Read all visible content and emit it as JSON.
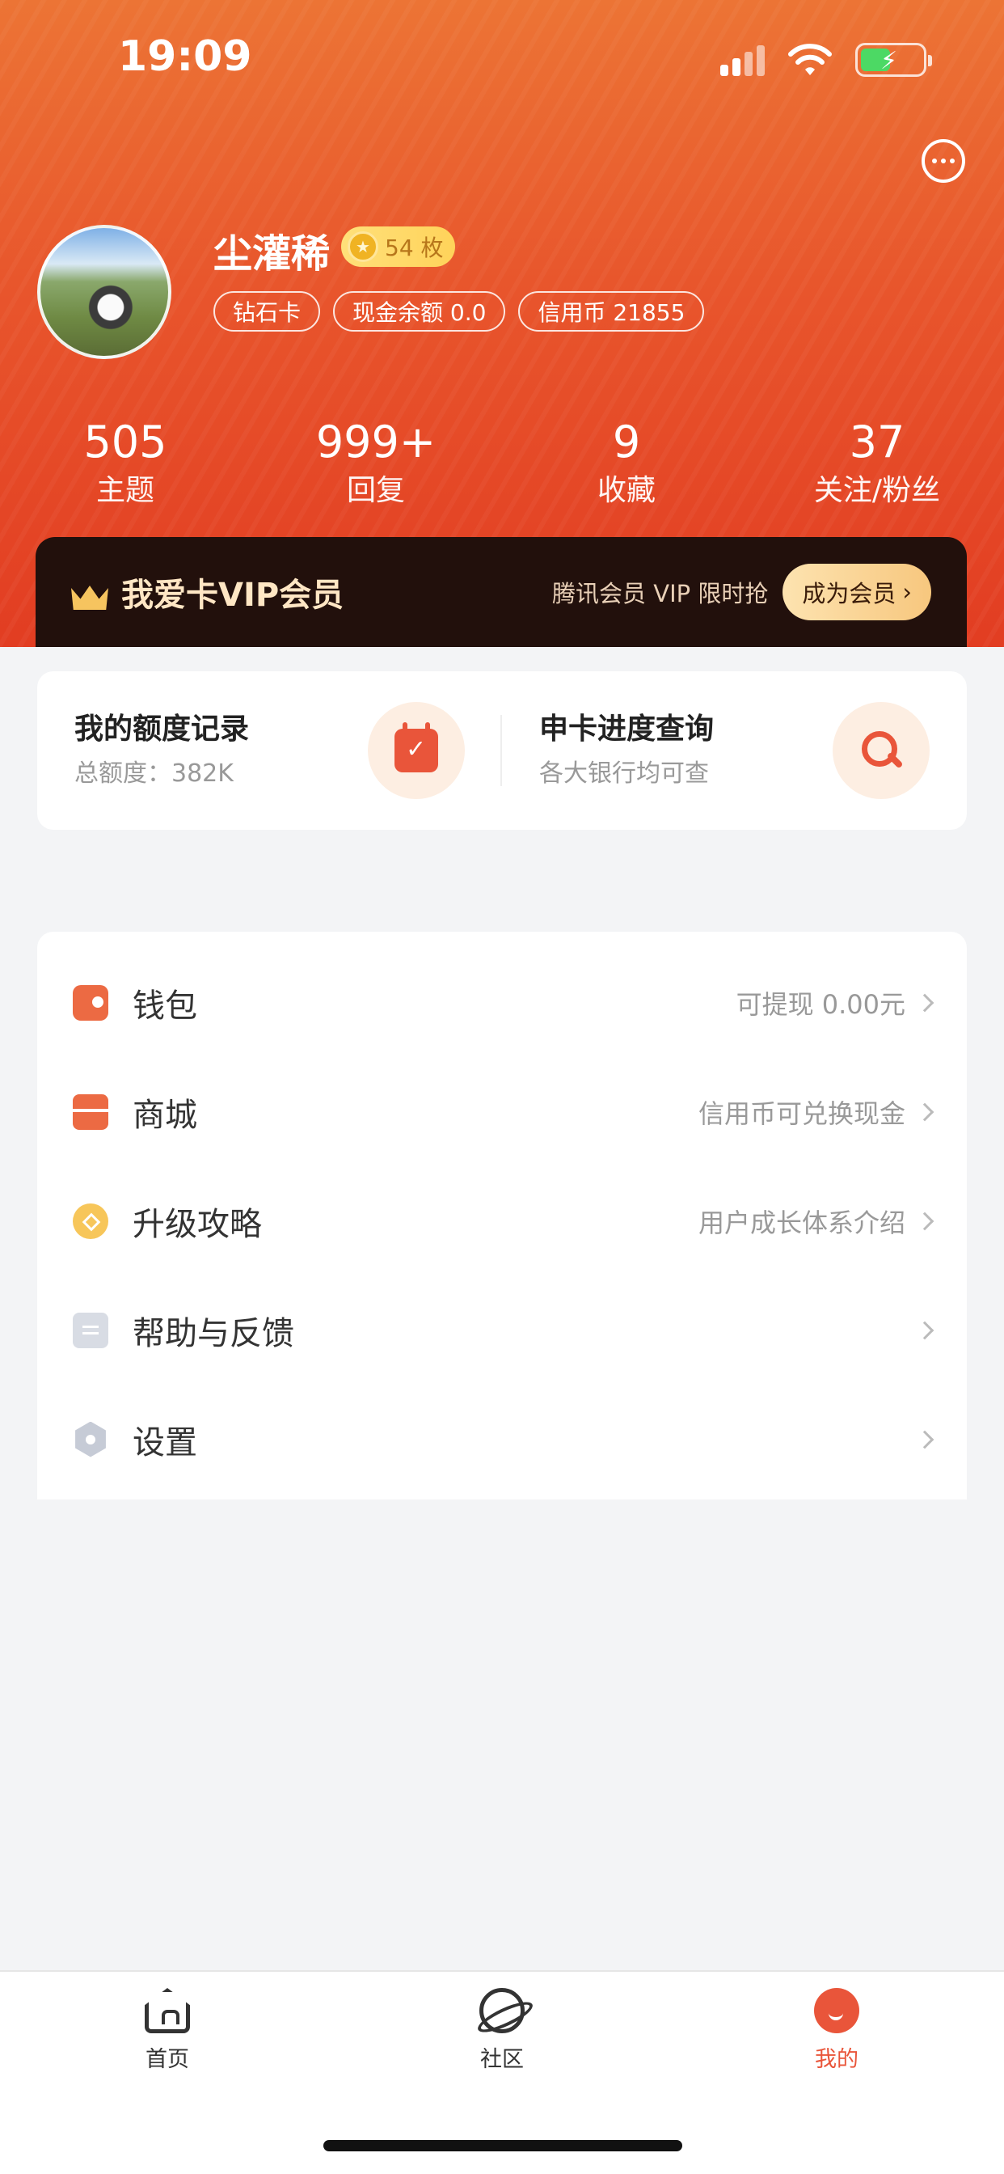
{
  "status_bar": {
    "time": "19:09"
  },
  "profile": {
    "username": "尘灌稀",
    "badge_text": "54 枚",
    "chips": [
      "钻石卡",
      "现金余额 0.0",
      "信用币 21855"
    ]
  },
  "stats": [
    {
      "value": "505",
      "label": "主题"
    },
    {
      "value": "999+",
      "label": "回复"
    },
    {
      "value": "9",
      "label": "收藏"
    },
    {
      "value": "37",
      "label": "关注/粉丝"
    }
  ],
  "vip": {
    "title": "我爱卡VIP会员",
    "subtitle": "腾讯会员 VIP 限时抢",
    "button": "成为会员"
  },
  "quick": [
    {
      "title": "我的额度记录",
      "subtitle": "总额度：382K",
      "icon": "calendar-check-icon"
    },
    {
      "title": "申卡进度查询",
      "subtitle": "各大银行均可查",
      "icon": "magnifier-icon"
    }
  ],
  "menu": [
    {
      "label": "钱包",
      "right": "可提现 0.00元",
      "icon": "wallet-icon"
    },
    {
      "label": "商城",
      "right": "信用币可兑换现金",
      "icon": "shop-icon"
    },
    {
      "label": "升级攻略",
      "right": "用户成长体系介绍",
      "icon": "upgrade-icon"
    },
    {
      "label": "帮助与反馈",
      "right": "",
      "icon": "help-icon"
    },
    {
      "label": "设置",
      "right": "",
      "icon": "settings-icon"
    }
  ],
  "tabs": [
    {
      "label": "首页",
      "icon": "home-icon",
      "active": false
    },
    {
      "label": "社区",
      "icon": "planet-icon",
      "active": false
    },
    {
      "label": "我的",
      "icon": "profile-icon",
      "active": true
    }
  ],
  "colors": {
    "accent": "#e9553a",
    "header_top": "#ec7435",
    "header_bottom": "#e23d22",
    "vip_bg": "#22100c"
  }
}
